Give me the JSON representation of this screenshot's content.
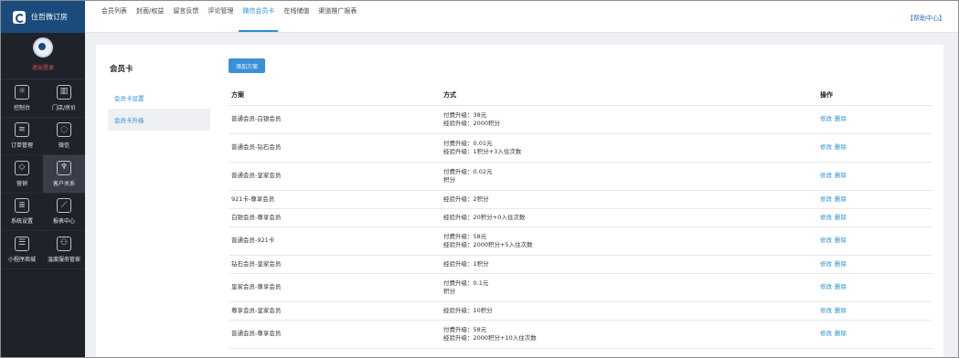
{
  "brand": {
    "name": "住哲微订房"
  },
  "user": {
    "logout": "退出登录"
  },
  "menu": [
    {
      "label": "控制台",
      "icon": "sun-icon",
      "glyph": "☼"
    },
    {
      "label": "门店/房价",
      "icon": "building-icon",
      "glyph": "▥"
    },
    {
      "label": "订单管理",
      "icon": "document-icon",
      "glyph": "≡"
    },
    {
      "label": "微信",
      "icon": "chat-icon",
      "glyph": "◌"
    },
    {
      "label": "营销",
      "icon": "ticket-icon",
      "glyph": "◇"
    },
    {
      "label": "客户关系",
      "icon": "wine-glass-icon",
      "glyph": "♆"
    },
    {
      "label": "系统设置",
      "icon": "sliders-icon",
      "glyph": "≣"
    },
    {
      "label": "报表中心",
      "icon": "chart-icon",
      "glyph": "⟋"
    },
    {
      "label": "小程序商城",
      "icon": "list-icon",
      "glyph": "☰"
    },
    {
      "label": "温度服务管家",
      "icon": "people-icon",
      "glyph": "⚇"
    }
  ],
  "topnav": {
    "tabs": [
      "会员列表",
      "封面/权益",
      "留言反馈",
      "评论管理",
      "微信会员卡",
      "在线储值",
      "渠道推广报表"
    ],
    "help": "【帮助中心】"
  },
  "subnav": {
    "title": "会员卡",
    "items": [
      "会员卡设置",
      "会员卡升级"
    ]
  },
  "add_button": "添加方案",
  "table": {
    "headers": [
      "方案",
      "方式",
      "操作"
    ],
    "edit": "修改",
    "delete": "删除",
    "rows": [
      {
        "plan": "普通会员-白银会员",
        "line1": "付费升级：38元",
        "line2": "经验升级：2000积分"
      },
      {
        "plan": "普通会员-钻石会员",
        "line1": "付费升级：0.01元",
        "line2": "经验升级：1积分+3入住次数"
      },
      {
        "plan": "普通会员-皇家会员",
        "line1": "付费升级：0.02元",
        "line2": "积分"
      },
      {
        "plan": "921卡-尊享会员",
        "line1": "经验升级：2积分",
        "line2": ""
      },
      {
        "plan": "白银会员-尊享会员",
        "line1": "经验升级：20积分+0入住次数",
        "line2": ""
      },
      {
        "plan": "普通会员-921卡",
        "line1": "付费升级：58元",
        "line2": "经验升级：2000积分+5入住次数"
      },
      {
        "plan": "钻石会员-皇家会员",
        "line1": "经验升级：1积分",
        "line2": ""
      },
      {
        "plan": "皇家会员-尊享会员",
        "line1": "付费升级：0.1元",
        "line2": "积分"
      },
      {
        "plan": "尊享会员-皇家会员",
        "line1": "经验升级：10积分",
        "line2": ""
      },
      {
        "plan": "普通会员-尊享会员",
        "line1": "付费升级：58元",
        "line2": "经验升级：2000积分+10入住次数"
      }
    ]
  }
}
